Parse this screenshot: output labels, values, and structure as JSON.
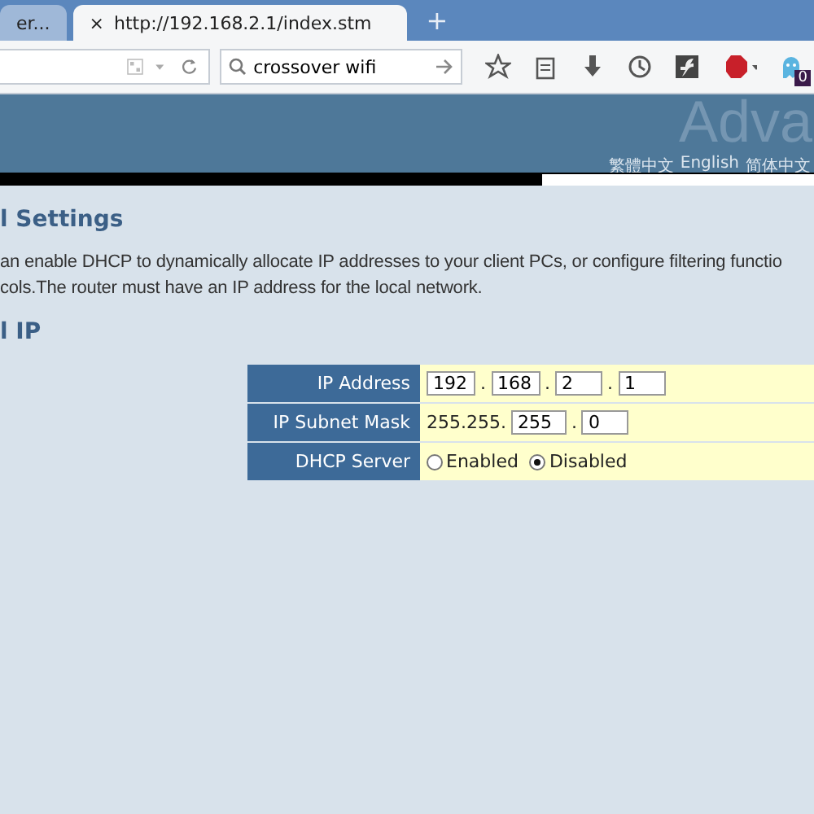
{
  "browser": {
    "tabs": [
      {
        "title": "er...",
        "selected": false
      },
      {
        "title": "http://192.168.2.1/index.stm",
        "selected": true,
        "close": "×"
      }
    ],
    "new_tab": "+",
    "search": {
      "value": "crossover wifi"
    },
    "badge": "0"
  },
  "banner": {
    "title": "Adva",
    "languages": [
      "繁體中文",
      "English",
      "简体中文"
    ]
  },
  "section": {
    "title": "l Settings",
    "description": "an enable DHCP to dynamically allocate IP addresses to your client PCs, or configure filtering functio\ncols.The router must have an IP address for the local network."
  },
  "subsection": {
    "title": "l IP"
  },
  "table": {
    "rows": [
      {
        "kind": "ip",
        "label": "IP Address",
        "separator": ".",
        "parts": [
          "192",
          "168",
          "2",
          "1"
        ]
      },
      {
        "kind": "ip",
        "label": "IP Subnet Mask",
        "prefix": "255.255.",
        "separator": ".",
        "parts": [
          "255",
          "0"
        ]
      },
      {
        "kind": "radio",
        "label": "DHCP Server",
        "options": [
          {
            "label": "Enabled",
            "selected": false
          },
          {
            "label": "Disabled",
            "selected": true
          }
        ]
      }
    ]
  }
}
